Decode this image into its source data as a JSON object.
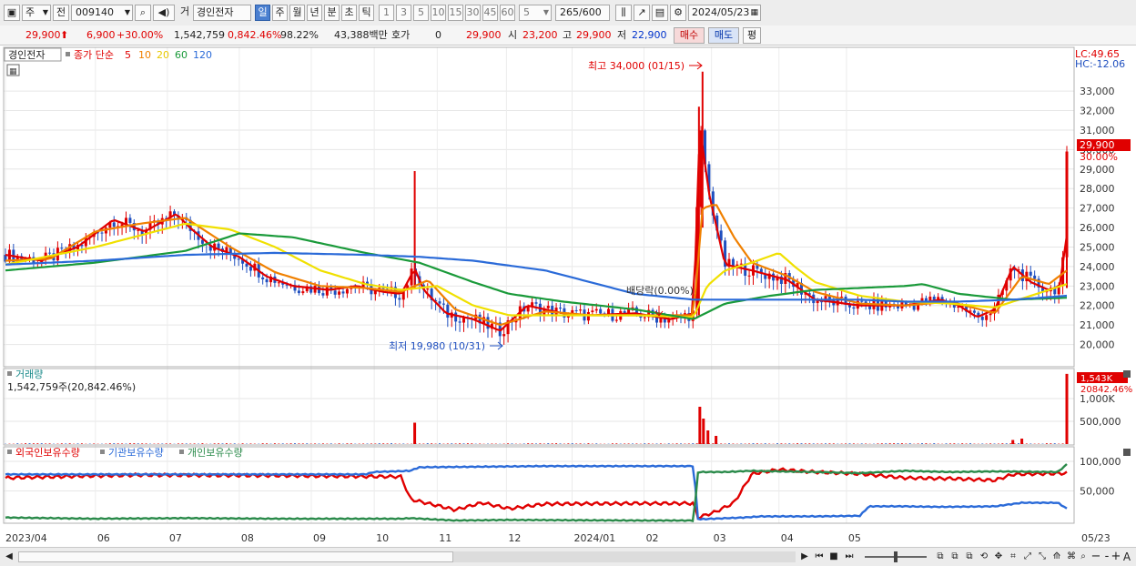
{
  "toolbar": {
    "market": "주",
    "prefix": "전",
    "stock_code": "009140",
    "exchange_label": "거",
    "stock_name": "경인전자",
    "periods": [
      "일",
      "주",
      "월",
      "년",
      "분",
      "초",
      "틱"
    ],
    "active_period": "일",
    "intervals": [
      "1",
      "3",
      "5",
      "10",
      "15",
      "30",
      "45",
      "60"
    ],
    "interval_value": "5",
    "count": "265",
    "count_total": "/600",
    "date": "2024/05/23"
  },
  "quote": {
    "price": "29,900",
    "change": "6,900",
    "change_pct": "+30.00%",
    "volume": "1,542,759",
    "volume_ratio": "0,842.46%",
    "rate": "98.22%",
    "amount": "43,388백만",
    "hoga_label": "호가",
    "hoga_value": "0",
    "hoga_price": "29,900",
    "open_label": "시",
    "open": "23,200",
    "high_label": "고",
    "high": "29,900",
    "low_label": "저",
    "low": "22,900",
    "buy_label": "매수",
    "sell_label": "매도",
    "flat_label": "평"
  },
  "colors": {
    "up": "#e00000",
    "down": "#1f4fbf",
    "ma5": "#e00000",
    "ma10": "#f08000",
    "ma20": "#f0e000",
    "ma60": "#1a9a3a",
    "ma120": "#2a6ad8",
    "foreign": "#e00000",
    "institution": "#2a6ad8",
    "individual": "#2a8a4a"
  },
  "price_panel": {
    "stock_label": "경인전자",
    "ma_label": "종가 단순",
    "ma_periods": [
      "5",
      "10",
      "20",
      "60",
      "120"
    ],
    "lc": "LC:49.65",
    "hc": "HC:-12.06",
    "high_annotation": "최고 34,000 (01/15)",
    "low_annotation": "최저 19,980 (10/31)",
    "dividend_annotation": "배당락(0.00%)",
    "last_price": "29,900",
    "last_pct": "30.00%"
  },
  "volume_panel": {
    "title": "거래량",
    "info": "1,542,759주(20,842.46%)",
    "last_value": "1,543K",
    "last_pct": "20842.46%"
  },
  "holding_panel": {
    "legend": [
      "외국인보유수량",
      "기관보유수량",
      "개인보유수량"
    ]
  },
  "icons": [
    "first-icon",
    "prev-icon",
    "stop-icon",
    "next-icon",
    "zoom-out-icon",
    "zoom-in-icon",
    "plus-icon",
    "font-icon"
  ],
  "chart_data": [
    {
      "type": "candlestick",
      "title": "",
      "ylim": [
        19000,
        34500
      ],
      "y_ticks": [
        "33,000",
        "32,000",
        "31,000",
        "30,000",
        "29,000",
        "28,000",
        "27,000",
        "26,000",
        "25,000",
        "24,000",
        "23,000",
        "22,000",
        "21,000",
        "20,000"
      ],
      "x_ticks": [
        "2023/04",
        "06",
        "07",
        "08",
        "09",
        "10",
        "11",
        "12",
        "2024/01",
        "02",
        "03",
        "04",
        "05",
        "05/23"
      ],
      "series": [
        {
          "name": "5",
          "keys": [
            [
              0,
              24600
            ],
            [
              0.04,
              24300
            ],
            [
              0.08,
              25000
            ],
            [
              0.12,
              26400
            ],
            [
              0.155,
              25800
            ],
            [
              0.19,
              26700
            ],
            [
              0.205,
              26000
            ],
            [
              0.23,
              25000
            ],
            [
              0.26,
              24500
            ],
            [
              0.29,
              23500
            ],
            [
              0.32,
              23000
            ],
            [
              0.36,
              22800
            ],
            [
              0.39,
              23000
            ],
            [
              0.42,
              22700
            ],
            [
              0.44,
              22600
            ],
            [
              0.455,
              23900
            ],
            [
              0.465,
              22800
            ],
            [
              0.49,
              21600
            ],
            [
              0.52,
              21300
            ],
            [
              0.55,
              20700
            ],
            [
              0.58,
              22000
            ],
            [
              0.62,
              21600
            ],
            [
              0.65,
              21500
            ],
            [
              0.7,
              21600
            ],
            [
              0.74,
              21300
            ],
            [
              0.765,
              21600
            ],
            [
              0.772,
              31200
            ],
            [
              0.782,
              27800
            ],
            [
              0.8,
              24100
            ],
            [
              0.83,
              23800
            ],
            [
              0.87,
              23300
            ],
            [
              0.9,
              22300
            ],
            [
              0.95,
              22000
            ],
            [
              1.0,
              22000
            ],
            [
              1.04,
              22300
            ],
            [
              1.06,
              22000
            ],
            [
              1.08,
              21400
            ],
            [
              1.1,
              21800
            ],
            [
              1.12,
              24000
            ],
            [
              1.14,
              23200
            ],
            [
              1.16,
              22800
            ],
            [
              1.172,
              23000
            ],
            [
              1.18,
              25600
            ]
          ]
        },
        {
          "name": "10",
          "keys": [
            [
              0,
              24300
            ],
            [
              0.05,
              24400
            ],
            [
              0.1,
              25800
            ],
            [
              0.15,
              26200
            ],
            [
              0.2,
              26500
            ],
            [
              0.25,
              25000
            ],
            [
              0.3,
              23700
            ],
            [
              0.35,
              23000
            ],
            [
              0.4,
              22900
            ],
            [
              0.44,
              22700
            ],
            [
              0.47,
              23300
            ],
            [
              0.5,
              21800
            ],
            [
              0.55,
              21000
            ],
            [
              0.6,
              21700
            ],
            [
              0.65,
              21500
            ],
            [
              0.7,
              21500
            ],
            [
              0.765,
              21500
            ],
            [
              0.775,
              27000
            ],
            [
              0.79,
              27200
            ],
            [
              0.81,
              25500
            ],
            [
              0.83,
              24200
            ],
            [
              0.87,
              23500
            ],
            [
              0.9,
              22700
            ],
            [
              0.95,
              22100
            ],
            [
              1.0,
              22000
            ],
            [
              1.05,
              22200
            ],
            [
              1.1,
              21600
            ],
            [
              1.13,
              23500
            ],
            [
              1.16,
              23100
            ],
            [
              1.18,
              23800
            ]
          ]
        },
        {
          "name": "20",
          "keys": [
            [
              0,
              24100
            ],
            [
              0.1,
              25000
            ],
            [
              0.2,
              26200
            ],
            [
              0.25,
              25900
            ],
            [
              0.3,
              25000
            ],
            [
              0.35,
              23800
            ],
            [
              0.4,
              23100
            ],
            [
              0.44,
              22800
            ],
            [
              0.48,
              23000
            ],
            [
              0.52,
              22000
            ],
            [
              0.56,
              21500
            ],
            [
              0.62,
              21500
            ],
            [
              0.7,
              21500
            ],
            [
              0.765,
              21400
            ],
            [
              0.78,
              23000
            ],
            [
              0.8,
              23800
            ],
            [
              0.83,
              24200
            ],
            [
              0.86,
              24700
            ],
            [
              0.88,
              23900
            ],
            [
              0.9,
              23200
            ],
            [
              0.95,
              22500
            ],
            [
              1.0,
              22200
            ],
            [
              1.05,
              22100
            ],
            [
              1.1,
              21900
            ],
            [
              1.14,
              22500
            ],
            [
              1.18,
              23100
            ]
          ]
        },
        {
          "name": "60",
          "keys": [
            [
              0,
              23800
            ],
            [
              0.1,
              24200
            ],
            [
              0.2,
              24800
            ],
            [
              0.26,
              25700
            ],
            [
              0.32,
              25500
            ],
            [
              0.4,
              24700
            ],
            [
              0.46,
              24200
            ],
            [
              0.52,
              23200
            ],
            [
              0.56,
              22600
            ],
            [
              0.62,
              22200
            ],
            [
              0.7,
              21800
            ],
            [
              0.765,
              21300
            ],
            [
              0.8,
              22100
            ],
            [
              0.85,
              22500
            ],
            [
              0.9,
              22800
            ],
            [
              0.95,
              22900
            ],
            [
              1.0,
              23000
            ],
            [
              1.02,
              23100
            ],
            [
              1.06,
              22600
            ],
            [
              1.12,
              22300
            ],
            [
              1.18,
              22400
            ]
          ]
        },
        {
          "name": "120",
          "keys": [
            [
              0,
              24100
            ],
            [
              0.1,
              24300
            ],
            [
              0.2,
              24600
            ],
            [
              0.3,
              24700
            ],
            [
              0.4,
              24600
            ],
            [
              0.46,
              24500
            ],
            [
              0.52,
              24300
            ],
            [
              0.6,
              23800
            ],
            [
              0.65,
              23200
            ],
            [
              0.7,
              22600
            ],
            [
              0.765,
              22300
            ],
            [
              0.85,
              22300
            ],
            [
              0.95,
              22300
            ],
            [
              1.0,
              22200
            ],
            [
              1.06,
              22200
            ],
            [
              1.12,
              22300
            ],
            [
              1.18,
              22500
            ]
          ]
        }
      ]
    },
    {
      "type": "bar",
      "title": "거래량",
      "ylim": [
        0,
        1600000
      ],
      "y_ticks": [
        "1,000K",
        "500,000"
      ],
      "spikes": [
        [
          0.455,
          470000
        ],
        [
          0.772,
          820000
        ],
        [
          0.776,
          560000
        ],
        [
          0.781,
          300000
        ],
        [
          0.79,
          180000
        ],
        [
          1.12,
          90000
        ],
        [
          1.13,
          120000
        ],
        [
          1.18,
          1542759
        ]
      ]
    },
    {
      "type": "line",
      "title": "외국인/기관/개인 보유수량",
      "ylim": [
        0,
        120000
      ],
      "y_ticks": [
        "100,000",
        "50,000"
      ],
      "series": [
        {
          "name": "외국인보유수량",
          "keys": [
            [
              0,
              72000
            ],
            [
              0.08,
              75000
            ],
            [
              0.15,
              77000
            ],
            [
              0.3,
              76000
            ],
            [
              0.44,
              74000
            ],
            [
              0.45,
              36000
            ],
            [
              0.5,
              18000
            ],
            [
              0.53,
              30000
            ],
            [
              0.56,
              20000
            ],
            [
              0.6,
              28000
            ],
            [
              0.7,
              29000
            ],
            [
              0.765,
              29000
            ],
            [
              0.77,
              5000
            ],
            [
              0.79,
              15000
            ],
            [
              0.81,
              30000
            ],
            [
              0.83,
              79000
            ],
            [
              0.86,
              86000
            ],
            [
              0.9,
              82000
            ],
            [
              0.95,
              79000
            ],
            [
              1.0,
              72000
            ],
            [
              1.05,
              71000
            ],
            [
              1.1,
              68000
            ],
            [
              1.12,
              78000
            ],
            [
              1.18,
              80000
            ]
          ]
        },
        {
          "name": "기관보유수량",
          "keys": [
            [
              0,
              78000
            ],
            [
              0.3,
              78000
            ],
            [
              0.4,
              78000
            ],
            [
              0.41,
              82000
            ],
            [
              0.45,
              84000
            ],
            [
              0.46,
              90000
            ],
            [
              0.6,
              92000
            ],
            [
              0.765,
              92000
            ],
            [
              0.77,
              2000
            ],
            [
              0.82,
              5000
            ],
            [
              0.84,
              7000
            ],
            [
              0.9,
              7000
            ],
            [
              0.95,
              8000
            ],
            [
              0.96,
              24000
            ],
            [
              1.0,
              24000
            ],
            [
              1.04,
              23000
            ],
            [
              1.1,
              24000
            ],
            [
              1.13,
              30000
            ],
            [
              1.17,
              30000
            ],
            [
              1.18,
              20000
            ]
          ]
        },
        {
          "name": "개인보유수량",
          "keys": [
            [
              0,
              5000
            ],
            [
              0.1,
              3000
            ],
            [
              0.2,
              4000
            ],
            [
              0.3,
              3000
            ],
            [
              0.4,
              3000
            ],
            [
              0.44,
              3000
            ],
            [
              0.45,
              4000
            ],
            [
              0.5,
              0
            ],
            [
              0.56,
              1000
            ],
            [
              0.7,
              0
            ],
            [
              0.765,
              0
            ],
            [
              0.77,
              82000
            ],
            [
              0.8,
              82000
            ],
            [
              0.83,
              84000
            ],
            [
              0.86,
              83000
            ],
            [
              0.9,
              82000
            ],
            [
              0.95,
              80000
            ],
            [
              1.0,
              84000
            ],
            [
              1.05,
              82000
            ],
            [
              1.1,
              83000
            ],
            [
              1.17,
              82000
            ],
            [
              1.18,
              95000
            ]
          ]
        }
      ]
    }
  ]
}
